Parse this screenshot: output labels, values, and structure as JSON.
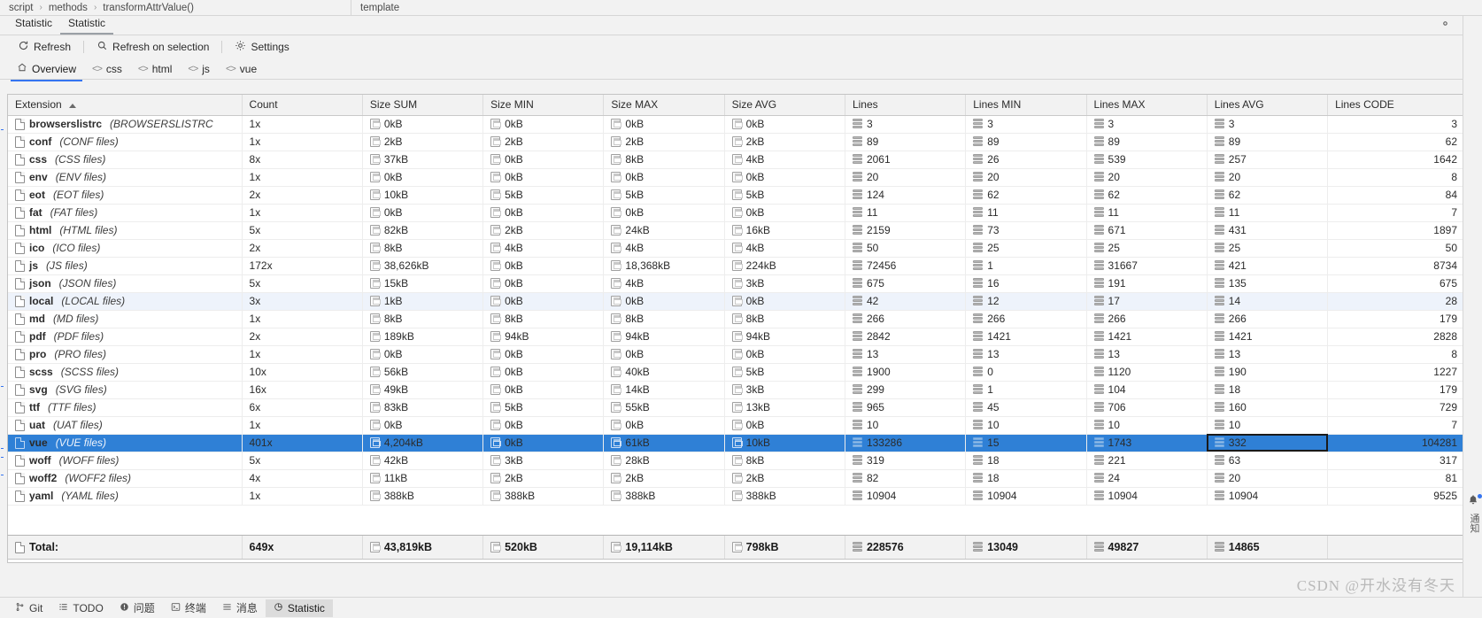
{
  "breadcrumb": {
    "segments": [
      "script",
      "methods",
      "transformAttrValue()"
    ],
    "separator": "›",
    "right_label": "template"
  },
  "tool_window": {
    "tabs": [
      {
        "label": "Statistic",
        "active": false
      },
      {
        "label": "Statistic",
        "active": true
      }
    ],
    "actions": {
      "settings_icon": "gear-icon",
      "minimize_icon": "minimize-icon"
    }
  },
  "toolbar": {
    "refresh_label": "Refresh",
    "refresh_icon": "refresh-icon",
    "refresh_on_selection_label": "Refresh on selection",
    "refresh_on_selection_icon": "magnifier-icon",
    "settings_label": "Settings",
    "settings_icon": "gear-icon"
  },
  "scopes": [
    {
      "label": "Overview",
      "icon": "home-icon",
      "active": true
    },
    {
      "label": "css",
      "icon": "angle-brackets-icon",
      "active": false
    },
    {
      "label": "html",
      "icon": "angle-brackets-icon",
      "active": false
    },
    {
      "label": "js",
      "icon": "angle-brackets-icon",
      "active": false
    },
    {
      "label": "vue",
      "icon": "angle-brackets-icon",
      "active": false
    }
  ],
  "table": {
    "sort_column": "Extension",
    "sort_direction": "asc",
    "columns": [
      "Extension",
      "Count",
      "Size SUM",
      "Size MIN",
      "Size MAX",
      "Size AVG",
      "Lines",
      "Lines MIN",
      "Lines MAX",
      "Lines AVG",
      "Lines CODE"
    ],
    "focused_cell": {
      "row": "vue",
      "column": "Lines AVG"
    },
    "selected_row": "vue",
    "alt_row": "local",
    "rows": [
      {
        "ext": "browserslistrc",
        "desc": "(BROWSERSLISTRC",
        "count": "1x",
        "size_sum": "0kB",
        "size_min": "0kB",
        "size_max": "0kB",
        "size_avg": "0kB",
        "lines": "3",
        "lines_min": "3",
        "lines_max": "3",
        "lines_avg": "3",
        "lines_code": "3"
      },
      {
        "ext": "conf",
        "desc": "(CONF files)",
        "count": "1x",
        "size_sum": "2kB",
        "size_min": "2kB",
        "size_max": "2kB",
        "size_avg": "2kB",
        "lines": "89",
        "lines_min": "89",
        "lines_max": "89",
        "lines_avg": "89",
        "lines_code": "62"
      },
      {
        "ext": "css",
        "desc": "(CSS files)",
        "count": "8x",
        "size_sum": "37kB",
        "size_min": "0kB",
        "size_max": "8kB",
        "size_avg": "4kB",
        "lines": "2061",
        "lines_min": "26",
        "lines_max": "539",
        "lines_avg": "257",
        "lines_code": "1642"
      },
      {
        "ext": "env",
        "desc": "(ENV files)",
        "count": "1x",
        "size_sum": "0kB",
        "size_min": "0kB",
        "size_max": "0kB",
        "size_avg": "0kB",
        "lines": "20",
        "lines_min": "20",
        "lines_max": "20",
        "lines_avg": "20",
        "lines_code": "8"
      },
      {
        "ext": "eot",
        "desc": "(EOT files)",
        "count": "2x",
        "size_sum": "10kB",
        "size_min": "5kB",
        "size_max": "5kB",
        "size_avg": "5kB",
        "lines": "124",
        "lines_min": "62",
        "lines_max": "62",
        "lines_avg": "62",
        "lines_code": "84"
      },
      {
        "ext": "fat",
        "desc": "(FAT files)",
        "count": "1x",
        "size_sum": "0kB",
        "size_min": "0kB",
        "size_max": "0kB",
        "size_avg": "0kB",
        "lines": "11",
        "lines_min": "11",
        "lines_max": "11",
        "lines_avg": "11",
        "lines_code": "7"
      },
      {
        "ext": "html",
        "desc": "(HTML files)",
        "count": "5x",
        "size_sum": "82kB",
        "size_min": "2kB",
        "size_max": "24kB",
        "size_avg": "16kB",
        "lines": "2159",
        "lines_min": "73",
        "lines_max": "671",
        "lines_avg": "431",
        "lines_code": "1897"
      },
      {
        "ext": "ico",
        "desc": "(ICO files)",
        "count": "2x",
        "size_sum": "8kB",
        "size_min": "4kB",
        "size_max": "4kB",
        "size_avg": "4kB",
        "lines": "50",
        "lines_min": "25",
        "lines_max": "25",
        "lines_avg": "25",
        "lines_code": "50"
      },
      {
        "ext": "js",
        "desc": "(JS files)",
        "count": "172x",
        "size_sum": "38,626kB",
        "size_min": "0kB",
        "size_max": "18,368kB",
        "size_avg": "224kB",
        "lines": "72456",
        "lines_min": "1",
        "lines_max": "31667",
        "lines_avg": "421",
        "lines_code": "8734"
      },
      {
        "ext": "json",
        "desc": "(JSON files)",
        "count": "5x",
        "size_sum": "15kB",
        "size_min": "0kB",
        "size_max": "4kB",
        "size_avg": "3kB",
        "lines": "675",
        "lines_min": "16",
        "lines_max": "191",
        "lines_avg": "135",
        "lines_code": "675"
      },
      {
        "ext": "local",
        "desc": "(LOCAL files)",
        "count": "3x",
        "size_sum": "1kB",
        "size_min": "0kB",
        "size_max": "0kB",
        "size_avg": "0kB",
        "lines": "42",
        "lines_min": "12",
        "lines_max": "17",
        "lines_avg": "14",
        "lines_code": "28"
      },
      {
        "ext": "md",
        "desc": "(MD files)",
        "count": "1x",
        "size_sum": "8kB",
        "size_min": "8kB",
        "size_max": "8kB",
        "size_avg": "8kB",
        "lines": "266",
        "lines_min": "266",
        "lines_max": "266",
        "lines_avg": "266",
        "lines_code": "179"
      },
      {
        "ext": "pdf",
        "desc": "(PDF files)",
        "count": "2x",
        "size_sum": "189kB",
        "size_min": "94kB",
        "size_max": "94kB",
        "size_avg": "94kB",
        "lines": "2842",
        "lines_min": "1421",
        "lines_max": "1421",
        "lines_avg": "1421",
        "lines_code": "2828"
      },
      {
        "ext": "pro",
        "desc": "(PRO files)",
        "count": "1x",
        "size_sum": "0kB",
        "size_min": "0kB",
        "size_max": "0kB",
        "size_avg": "0kB",
        "lines": "13",
        "lines_min": "13",
        "lines_max": "13",
        "lines_avg": "13",
        "lines_code": "8"
      },
      {
        "ext": "scss",
        "desc": "(SCSS files)",
        "count": "10x",
        "size_sum": "56kB",
        "size_min": "0kB",
        "size_max": "40kB",
        "size_avg": "5kB",
        "lines": "1900",
        "lines_min": "0",
        "lines_max": "1120",
        "lines_avg": "190",
        "lines_code": "1227"
      },
      {
        "ext": "svg",
        "desc": "(SVG files)",
        "count": "16x",
        "size_sum": "49kB",
        "size_min": "0kB",
        "size_max": "14kB",
        "size_avg": "3kB",
        "lines": "299",
        "lines_min": "1",
        "lines_max": "104",
        "lines_avg": "18",
        "lines_code": "179"
      },
      {
        "ext": "ttf",
        "desc": "(TTF files)",
        "count": "6x",
        "size_sum": "83kB",
        "size_min": "5kB",
        "size_max": "55kB",
        "size_avg": "13kB",
        "lines": "965",
        "lines_min": "45",
        "lines_max": "706",
        "lines_avg": "160",
        "lines_code": "729"
      },
      {
        "ext": "uat",
        "desc": "(UAT files)",
        "count": "1x",
        "size_sum": "0kB",
        "size_min": "0kB",
        "size_max": "0kB",
        "size_avg": "0kB",
        "lines": "10",
        "lines_min": "10",
        "lines_max": "10",
        "lines_avg": "10",
        "lines_code": "7"
      },
      {
        "ext": "vue",
        "desc": "(VUE files)",
        "count": "401x",
        "size_sum": "4,204kB",
        "size_min": "0kB",
        "size_max": "61kB",
        "size_avg": "10kB",
        "lines": "133286",
        "lines_min": "15",
        "lines_max": "1743",
        "lines_avg": "332",
        "lines_code": "104281"
      },
      {
        "ext": "woff",
        "desc": "(WOFF files)",
        "count": "5x",
        "size_sum": "42kB",
        "size_min": "3kB",
        "size_max": "28kB",
        "size_avg": "8kB",
        "lines": "319",
        "lines_min": "18",
        "lines_max": "221",
        "lines_avg": "63",
        "lines_code": "317"
      },
      {
        "ext": "woff2",
        "desc": "(WOFF2 files)",
        "count": "4x",
        "size_sum": "11kB",
        "size_min": "2kB",
        "size_max": "2kB",
        "size_avg": "2kB",
        "lines": "82",
        "lines_min": "18",
        "lines_max": "24",
        "lines_avg": "20",
        "lines_code": "81"
      },
      {
        "ext": "yaml",
        "desc": "(YAML files)",
        "count": "1x",
        "size_sum": "388kB",
        "size_min": "388kB",
        "size_max": "388kB",
        "size_avg": "388kB",
        "lines": "10904",
        "lines_min": "10904",
        "lines_max": "10904",
        "lines_avg": "10904",
        "lines_code": "9525"
      }
    ],
    "total": {
      "label": "Total:",
      "count": "649x",
      "size_sum": "43,819kB",
      "size_min": "520kB",
      "size_max": "19,114kB",
      "size_avg": "798kB",
      "lines": "228576",
      "lines_min": "13049",
      "lines_max": "49827",
      "lines_avg": "14865",
      "lines_code": ""
    }
  },
  "statusbar": {
    "items": [
      {
        "label": "Git",
        "icon": "branch-icon",
        "active": false
      },
      {
        "label": "TODO",
        "icon": "list-icon",
        "active": false
      },
      {
        "label": "问题",
        "icon": "warning-icon",
        "active": false
      },
      {
        "label": "终端",
        "icon": "terminal-icon",
        "active": false
      },
      {
        "label": "消息",
        "icon": "messages-icon",
        "active": false
      },
      {
        "label": "Statistic",
        "icon": "pie-chart-icon",
        "active": true
      }
    ]
  },
  "right_rail": {
    "bell_icon": "notification-bell-icon",
    "label": "通知"
  },
  "watermark": "CSDN @开水没有冬天",
  "colors": {
    "selection": "#2f80d6",
    "accent": "#3574f0",
    "alt_row": "#eef3fb",
    "panel": "#f2f2f2"
  }
}
